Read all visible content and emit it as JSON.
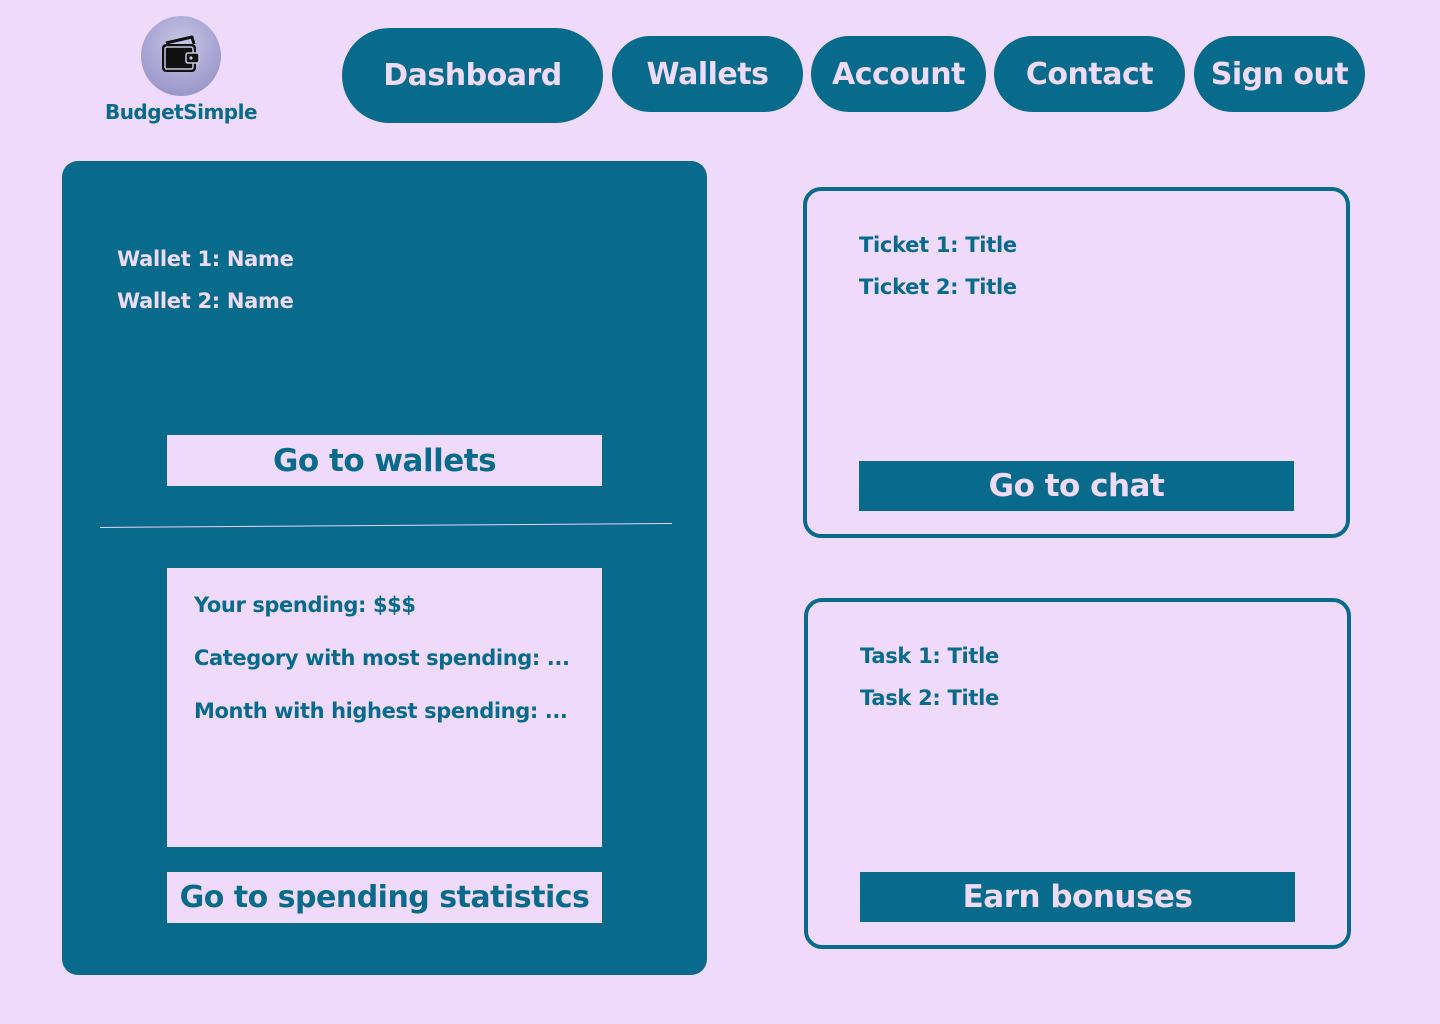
{
  "brand": {
    "name": "BudgetSimple",
    "logo_icon": "wallet-icon"
  },
  "nav": {
    "dashboard": "Dashboard",
    "wallets": "Wallets",
    "account": "Account",
    "contact": "Contact",
    "sign_out": "Sign out"
  },
  "wallets_panel": {
    "items": [
      "Wallet 1: Name",
      "Wallet 2: Name"
    ],
    "button": "Go to wallets"
  },
  "spending": {
    "lines": [
      "Your spending: $$$",
      "Category with most spending: ...",
      "Month with highest spending: ..."
    ],
    "button": "Go to spending statistics"
  },
  "tickets": {
    "items": [
      "Ticket 1: Title",
      "Ticket 2: Title"
    ],
    "button": "Go to chat"
  },
  "tasks": {
    "items": [
      "Task 1: Title",
      "Task 2: Title"
    ],
    "button": "Earn bonuses"
  },
  "colors": {
    "background": "#f0dafc",
    "primary": "#086b8b"
  }
}
